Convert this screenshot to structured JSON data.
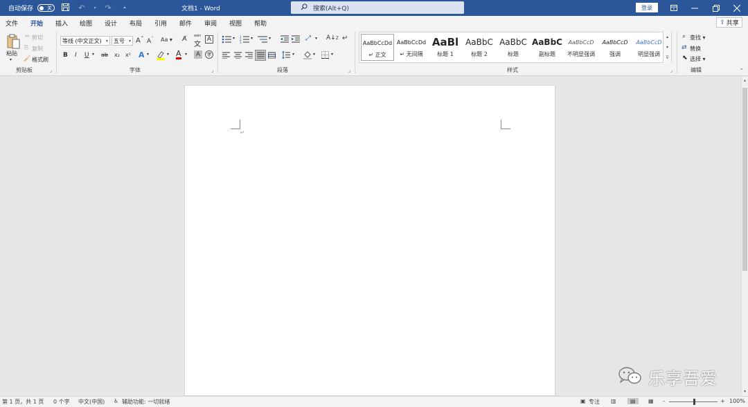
{
  "titlebar": {
    "autosave_label": "自动保存",
    "autosave_state": "关",
    "doc_title": "文档1 - Word",
    "search_placeholder": "搜索(Alt+Q)",
    "login_label": "登录"
  },
  "menu": {
    "tabs": [
      "文件",
      "开始",
      "插入",
      "绘图",
      "设计",
      "布局",
      "引用",
      "邮件",
      "审阅",
      "视图",
      "帮助"
    ],
    "active_tab": "开始",
    "share_label": "共享"
  },
  "ribbon": {
    "clipboard": {
      "paste": "粘贴",
      "cut": "剪切",
      "copy": "复制",
      "format_painter": "格式刷",
      "label": "剪贴板"
    },
    "font": {
      "font_name": "等线 (中文正文)",
      "font_size": "五号",
      "grow": "A",
      "shrink": "A",
      "change_case": "Aa",
      "wen": "wén",
      "char_border": "A",
      "bold": "B",
      "italic": "I",
      "underline": "U",
      "strike": "ab",
      "subscript": "x₂",
      "superscript": "x²",
      "text_effects": "A",
      "font_color": "A",
      "char_shading": "A",
      "enclose": "字",
      "label": "字体"
    },
    "paragraph": {
      "label": "段落"
    },
    "styles": {
      "label": "样式",
      "items": [
        {
          "preview": "AaBbCcDd",
          "name": "正文",
          "marker": "↵"
        },
        {
          "preview": "AaBbCcDd",
          "name": "无间隔",
          "marker": "↵"
        },
        {
          "preview": "AaBl",
          "name": "标题 1",
          "marker": ""
        },
        {
          "preview": "AaBbC",
          "name": "标题 2",
          "marker": ""
        },
        {
          "preview": "AaBbC",
          "name": "标题",
          "marker": ""
        },
        {
          "preview": "AaBbC",
          "name": "副标题",
          "marker": ""
        },
        {
          "preview": "AaBbCcD",
          "name": "不明显强调",
          "marker": ""
        },
        {
          "preview": "AaBbCcD",
          "name": "强调",
          "marker": ""
        },
        {
          "preview": "AaBbCcD",
          "name": "明显强调",
          "marker": ""
        }
      ]
    },
    "editing": {
      "find": "查找",
      "replace": "替换",
      "select": "选择",
      "label": "编辑"
    }
  },
  "document": {
    "paragraph_mark": "↵"
  },
  "statusbar": {
    "page": "第 1 页，共 1 页",
    "words": "0 个字",
    "language": "中文(中国)",
    "accessibility": "辅助功能: 一切就绪",
    "focus": "专注",
    "zoom_minus": "-",
    "zoom_plus": "+",
    "zoom": "100%",
    "zoom_level_percent": 100
  },
  "watermark": {
    "text": "乐享吾爱"
  },
  "colors": {
    "accent": "#2b579a",
    "highlight": "#ffff00",
    "font_color": "#e00000"
  }
}
